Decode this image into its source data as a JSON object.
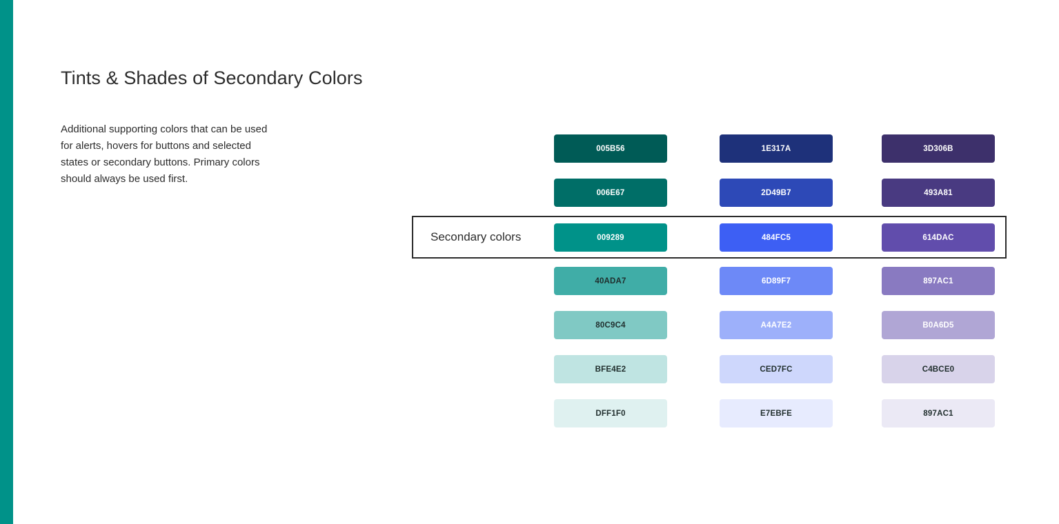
{
  "page": {
    "title": "Tints & Shades of Secondary Colors",
    "description": "Additional supporting colors that can be used for alerts, hovers for buttons and selected states or secondary buttons. Primary colors should always be used first.",
    "highlight_label": "Secondary colors",
    "accent_color": "#009289"
  },
  "palettes": [
    {
      "swatches": [
        {
          "label": "005B56",
          "color": "#005B56",
          "text_color": "#ffffff"
        },
        {
          "label": "006E67",
          "color": "#006E67",
          "text_color": "#ffffff"
        },
        {
          "label": "009289",
          "color": "#009289",
          "text_color": "#ffffff"
        },
        {
          "label": "40ADA7",
          "color": "#40ADA7",
          "text_color": "#1f2d2c"
        },
        {
          "label": "80C9C4",
          "color": "#80C9C4",
          "text_color": "#1f2d2c"
        },
        {
          "label": "BFE4E2",
          "color": "#BFE4E2",
          "text_color": "#1f2d2c"
        },
        {
          "label": "DFF1F0",
          "color": "#DFF1F0",
          "text_color": "#1f2d2c"
        }
      ]
    },
    {
      "swatches": [
        {
          "label": "1E317A",
          "color": "#1E317A",
          "text_color": "#ffffff"
        },
        {
          "label": "2D49B7",
          "color": "#2D49B7",
          "text_color": "#ffffff"
        },
        {
          "label": "484FC5",
          "color": "#3D5FF4",
          "text_color": "#ffffff"
        },
        {
          "label": "6D89F7",
          "color": "#6D89F7",
          "text_color": "#ffffff"
        },
        {
          "label": "A4A7E2",
          "color": "#9DB0FA",
          "text_color": "#ffffff"
        },
        {
          "label": "CED7FC",
          "color": "#CED7FC",
          "text_color": "#1f2d2c"
        },
        {
          "label": "E7EBFE",
          "color": "#E7EBFE",
          "text_color": "#1f2d2c"
        }
      ]
    },
    {
      "swatches": [
        {
          "label": "3D306B",
          "color": "#3D306B",
          "text_color": "#ffffff"
        },
        {
          "label": "493A81",
          "color": "#493A81",
          "text_color": "#ffffff"
        },
        {
          "label": "614DAC",
          "color": "#614DAC",
          "text_color": "#ffffff"
        },
        {
          "label": "897AC1",
          "color": "#897AC1",
          "text_color": "#ffffff"
        },
        {
          "label": "B0A6D5",
          "color": "#B0A6D5",
          "text_color": "#ffffff"
        },
        {
          "label": "C4BCE0",
          "color": "#D8D3EA",
          "text_color": "#1f2d2c"
        },
        {
          "label": "897AC1",
          "color": "#EBE9F5",
          "text_color": "#1f2d2c"
        }
      ]
    }
  ]
}
